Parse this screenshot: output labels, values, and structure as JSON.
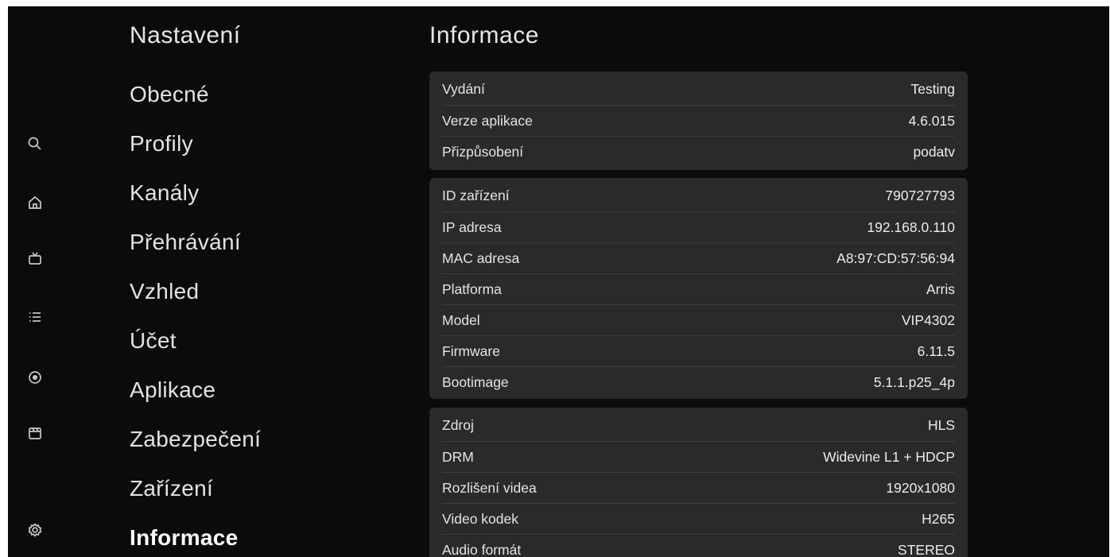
{
  "rail": {
    "icons": [
      "search-icon",
      "home-icon",
      "tv-icon",
      "list-icon",
      "record-icon",
      "clapper-icon",
      "settings-icon"
    ]
  },
  "menu": {
    "title": "Nastavení",
    "items": [
      {
        "label": "Obecné"
      },
      {
        "label": "Profily"
      },
      {
        "label": "Kanály"
      },
      {
        "label": "Přehrávání"
      },
      {
        "label": "Vzhled"
      },
      {
        "label": "Účet"
      },
      {
        "label": "Aplikace"
      },
      {
        "label": "Zabezpečení"
      },
      {
        "label": "Zařízení"
      },
      {
        "label": "Informace",
        "active": true
      }
    ]
  },
  "info": {
    "title": "Informace",
    "cards": [
      {
        "rows": [
          {
            "label": "Vydání",
            "value": "Testing"
          },
          {
            "label": "Verze aplikace",
            "value": "4.6.015"
          },
          {
            "label": "Přizpůsobení",
            "value": "podatv"
          }
        ]
      },
      {
        "rows": [
          {
            "label": "ID zařízení",
            "value": "790727793"
          },
          {
            "label": "IP adresa",
            "value": "192.168.0.110"
          },
          {
            "label": "MAC adresa",
            "value": "A8:97:CD:57:56:94"
          },
          {
            "label": "Platforma",
            "value": "Arris"
          },
          {
            "label": "Model",
            "value": "VIP4302"
          },
          {
            "label": "Firmware",
            "value": "6.11.5"
          },
          {
            "label": "Bootimage",
            "value": "5.1.1.p25_4p"
          }
        ]
      },
      {
        "rows": [
          {
            "label": "Zdroj",
            "value": "HLS"
          },
          {
            "label": "DRM",
            "value": "Widevine L1 + HDCP"
          },
          {
            "label": "Rozlišení videa",
            "value": "1920x1080"
          },
          {
            "label": "Video kodek",
            "value": "H265"
          },
          {
            "label": "Audio formát",
            "value": "STEREO"
          }
        ]
      }
    ]
  }
}
